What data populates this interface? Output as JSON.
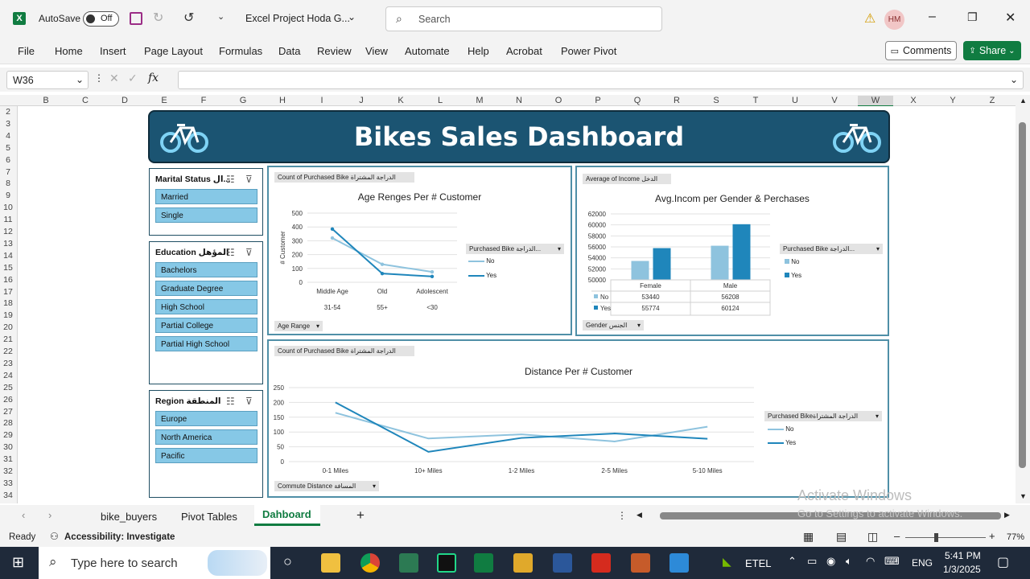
{
  "titlebar": {
    "autosave_label": "AutoSave",
    "autosave_state": "Off",
    "file_name": "Excel Project Hoda G...",
    "search_placeholder": "Search",
    "user_initials": "HM"
  },
  "ribbon": {
    "tabs": [
      "File",
      "Home",
      "Insert",
      "Page Layout",
      "Formulas",
      "Data",
      "Review",
      "View",
      "Automate",
      "Help",
      "Acrobat",
      "Power Pivot"
    ],
    "comments_label": "Comments",
    "share_label": "Share"
  },
  "formula": {
    "name_box": "W36",
    "fx": "fx",
    "value": ""
  },
  "columns": [
    "B",
    "C",
    "D",
    "E",
    "F",
    "G",
    "H",
    "I",
    "J",
    "K",
    "L",
    "M",
    "N",
    "O",
    "P",
    "Q",
    "R",
    "S",
    "T",
    "U",
    "V",
    "W",
    "X",
    "Y",
    "Z"
  ],
  "rows": [
    "2",
    "3",
    "4",
    "5",
    "6",
    "7",
    "8",
    "9",
    "10",
    "11",
    "12",
    "13",
    "14",
    "15",
    "16",
    "17",
    "18",
    "19",
    "20",
    "21",
    "22",
    "23",
    "24",
    "25",
    "26",
    "27",
    "28",
    "29",
    "30",
    "31",
    "32",
    "33",
    "34"
  ],
  "dashboard": {
    "title": "Bikes Sales Dashboard",
    "slicers": {
      "marital": {
        "title": "Marital Status ال...",
        "items": [
          "Married",
          "Single"
        ]
      },
      "education": {
        "title": "Education المؤهل",
        "items": [
          "Bachelors",
          "Graduate Degree",
          "High School",
          "Partial College",
          "Partial High School"
        ]
      },
      "region": {
        "title": "Region المنطقة",
        "items": [
          "Europe",
          "North America",
          "Pacific"
        ]
      }
    },
    "age_panel": {
      "field_pill": "Count of Purchased Bike الدراجة المشتراة",
      "legend_pill": "Purchased Bike الدراجة...",
      "axis_pill": "Age Range",
      "sub_labels": [
        "31-54",
        "55+",
        "<30"
      ]
    },
    "income_panel": {
      "field_pill": "Average of Income الدخل",
      "legend_pill": "Purchased Bike الدراجة...",
      "axis_pill": "Gender الجنس"
    },
    "distance_panel": {
      "field_pill": "Count of Purchased Bike الدراجة المشتراة",
      "legend_pill": "Purchased Bikeالدراجة المشتراة",
      "axis_pill": "Commute Distance المسافة"
    },
    "watermark": {
      "line1": "Activate Windows",
      "line2": "Go to Settings to activate Windows."
    }
  },
  "chart_data": [
    {
      "type": "line",
      "title": "Age Renges Per # Customer",
      "ylabel": "# Customer",
      "categories": [
        "Middle Age",
        "Old",
        "Adolescent"
      ],
      "ylim": [
        0,
        500
      ],
      "yticks": [
        "500",
        "400",
        "300",
        "200",
        "100",
        "0"
      ],
      "series": [
        {
          "name": "No",
          "values": [
            320,
            130,
            75
          ],
          "color": "#8ec3de"
        },
        {
          "name": "Yes",
          "values": [
            385,
            63,
            42
          ],
          "color": "#1f86bb"
        }
      ]
    },
    {
      "type": "bar",
      "title": "Avg.Incom per Gender & Perchases",
      "categories": [
        "Female",
        "Male"
      ],
      "ylim": [
        50000,
        62000
      ],
      "yticks": [
        "62000",
        "60000",
        "58000",
        "56000",
        "54000",
        "52000",
        "50000"
      ],
      "series": [
        {
          "name": "No",
          "values": [
            53440,
            56208
          ],
          "color": "#8ec3de"
        },
        {
          "name": "Yes",
          "values": [
            55774,
            60124
          ],
          "color": "#1f86bb"
        }
      ],
      "table": [
        [
          "No",
          "53440",
          "56208"
        ],
        [
          "Yes",
          "55774",
          "60124"
        ]
      ]
    },
    {
      "type": "line",
      "title": "Distance Per # Customer",
      "categories": [
        "0-1 Miles",
        "10+ Miles",
        "1-2 Miles",
        "2-5 Miles",
        "5-10 Miles"
      ],
      "ylim": [
        0,
        250
      ],
      "yticks": [
        "250",
        "200",
        "150",
        "100",
        "50",
        "0"
      ],
      "series": [
        {
          "name": "No",
          "values": [
            165,
            78,
            92,
            68,
            118
          ],
          "color": "#8ec3de"
        },
        {
          "name": "Yes",
          "values": [
            200,
            33,
            80,
            95,
            77
          ],
          "color": "#1f86bb"
        }
      ]
    }
  ],
  "sheet_tabs": [
    "bike_buyers",
    "Pivot Tables",
    "Dahboard"
  ],
  "status": {
    "ready": "Ready",
    "accessibility": "Accessibility: Investigate",
    "zoom": "77%"
  },
  "taskbar": {
    "search_placeholder": "Type here to search",
    "network": "ETEL",
    "lang": "ENG",
    "time": "5:41 PM",
    "date": "1/3/2025"
  }
}
